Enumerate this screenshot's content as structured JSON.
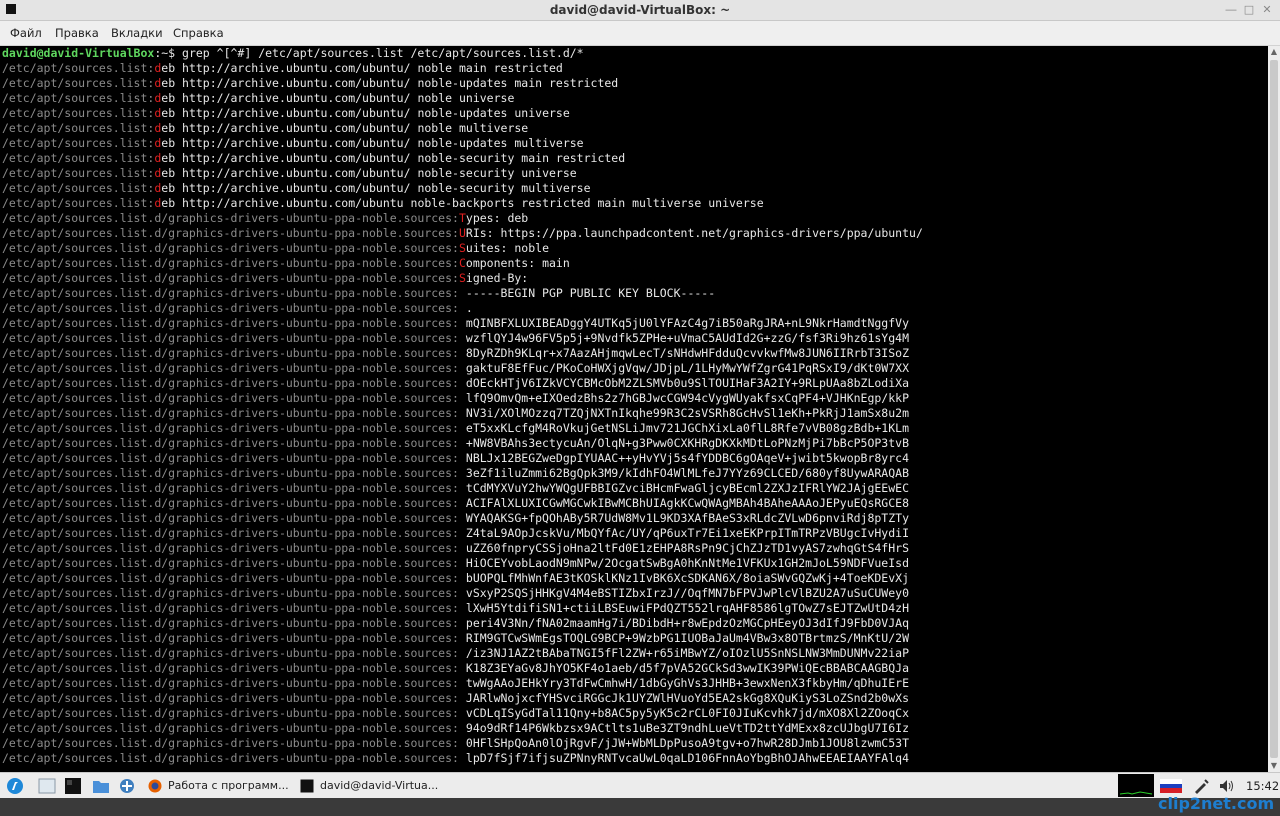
{
  "window": {
    "title": "david@david-VirtualBox: ~",
    "controls": [
      "minimize-icon",
      "maximize-icon",
      "close-icon"
    ]
  },
  "menu": [
    "Файл",
    "Правка",
    "Вкладки",
    "Справка"
  ],
  "terminal": {
    "prompt": "david@david-VirtualBox",
    "prompt_suffix": ":~$ ",
    "command": "grep ^[^#] /etc/apt/sources.list /etc/apt/sources.list.d/*",
    "lines": [
      {
        "p": "/etc/apt/sources.list:",
        "h": "d",
        "r": "eb http://archive.ubuntu.com/ubuntu/ noble main restricted"
      },
      {
        "p": "/etc/apt/sources.list:",
        "h": "d",
        "r": "eb http://archive.ubuntu.com/ubuntu/ noble-updates main restricted"
      },
      {
        "p": "/etc/apt/sources.list:",
        "h": "d",
        "r": "eb http://archive.ubuntu.com/ubuntu/ noble universe"
      },
      {
        "p": "/etc/apt/sources.list:",
        "h": "d",
        "r": "eb http://archive.ubuntu.com/ubuntu/ noble-updates universe"
      },
      {
        "p": "/etc/apt/sources.list:",
        "h": "d",
        "r": "eb http://archive.ubuntu.com/ubuntu/ noble multiverse"
      },
      {
        "p": "/etc/apt/sources.list:",
        "h": "d",
        "r": "eb http://archive.ubuntu.com/ubuntu/ noble-updates multiverse"
      },
      {
        "p": "/etc/apt/sources.list:",
        "h": "d",
        "r": "eb http://archive.ubuntu.com/ubuntu/ noble-security main restricted"
      },
      {
        "p": "/etc/apt/sources.list:",
        "h": "d",
        "r": "eb http://archive.ubuntu.com/ubuntu/ noble-security universe"
      },
      {
        "p": "/etc/apt/sources.list:",
        "h": "d",
        "r": "eb http://archive.ubuntu.com/ubuntu/ noble-security multiverse"
      },
      {
        "p": "/etc/apt/sources.list:",
        "h": "d",
        "r": "eb http://archive.ubuntu.com/ubuntu noble-backports restricted main multiverse universe"
      },
      {
        "p": "/etc/apt/sources.list.d/graphics-drivers-ubuntu-ppa-noble.sources:",
        "h": "T",
        "r": "ypes: deb"
      },
      {
        "p": "/etc/apt/sources.list.d/graphics-drivers-ubuntu-ppa-noble.sources:",
        "h": "U",
        "r": "RIs: https://ppa.launchpadcontent.net/graphics-drivers/ppa/ubuntu/"
      },
      {
        "p": "/etc/apt/sources.list.d/graphics-drivers-ubuntu-ppa-noble.sources:",
        "h": "S",
        "r": "uites: noble"
      },
      {
        "p": "/etc/apt/sources.list.d/graphics-drivers-ubuntu-ppa-noble.sources:",
        "h": "C",
        "r": "omponents: main"
      },
      {
        "p": "/etc/apt/sources.list.d/graphics-drivers-ubuntu-ppa-noble.sources:",
        "h": "S",
        "r": "igned-By:"
      },
      {
        "p": "/etc/apt/sources.list.d/graphics-drivers-ubuntu-ppa-noble.sources:",
        "h": "",
        "r": " -----BEGIN PGP PUBLIC KEY BLOCK-----"
      },
      {
        "p": "/etc/apt/sources.list.d/graphics-drivers-ubuntu-ppa-noble.sources:",
        "h": "",
        "r": " ."
      },
      {
        "p": "/etc/apt/sources.list.d/graphics-drivers-ubuntu-ppa-noble.sources:",
        "h": "",
        "r": " mQINBFXLUXIBEADggY4UTKq5jU0lYFAzC4g7iB50aRgJRA+nL9NkrHamdtNggfVy"
      },
      {
        "p": "/etc/apt/sources.list.d/graphics-drivers-ubuntu-ppa-noble.sources:",
        "h": "",
        "r": " wzflQYJ4w96FV5p5j+9Nvdfk5ZPHe+uVmaC5AUdId2G+zzG/fsf3Ri9hz61sYg4M"
      },
      {
        "p": "/etc/apt/sources.list.d/graphics-drivers-ubuntu-ppa-noble.sources:",
        "h": "",
        "r": " 8DyRZDh9KLqr+x7AazAHjmqwLecT/sNHdwHFdduQcvvkwfMw8JUN6IIRrbT3ISoZ"
      },
      {
        "p": "/etc/apt/sources.list.d/graphics-drivers-ubuntu-ppa-noble.sources:",
        "h": "",
        "r": " gaktuF8EfFuc/PKoCoHWXjgVqw/JDjpL/1LHyMwYWfZgrG41PqRSxI9/dKt0W7XX"
      },
      {
        "p": "/etc/apt/sources.list.d/graphics-drivers-ubuntu-ppa-noble.sources:",
        "h": "",
        "r": " dOEckHTjV6IZkVCYCBMcObM2ZLSMVb0u9SlTOUIHaF3A2IY+9RLpUAa8bZLodiXa"
      },
      {
        "p": "/etc/apt/sources.list.d/graphics-drivers-ubuntu-ppa-noble.sources:",
        "h": "",
        "r": " lfQ9OmvQm+eIXOedzBhs2z7hGBJwcCGW94cVygWUyakfsxCqPF4+VJHKnEgp/kkP"
      },
      {
        "p": "/etc/apt/sources.list.d/graphics-drivers-ubuntu-ppa-noble.sources:",
        "h": "",
        "r": " NV3i/XOlMOzzq7TZQjNXTnIkqhe99R3C2sVSRh8GcHvSl1eKh+PkRjJ1amSx8u2m"
      },
      {
        "p": "/etc/apt/sources.list.d/graphics-drivers-ubuntu-ppa-noble.sources:",
        "h": "",
        "r": " eT5xxKLcfgM4RoVkujGetNSLiJmv721JGChXixLa0flL8Rfe7vVB08gzBdb+1KLm"
      },
      {
        "p": "/etc/apt/sources.list.d/graphics-drivers-ubuntu-ppa-noble.sources:",
        "h": "",
        "r": " +NW8VBAhs3ectycuAn/OlqN+g3Pww0CXKHRgDKXkMDtLoPNzMjPi7bBcP5OP3tvB"
      },
      {
        "p": "/etc/apt/sources.list.d/graphics-drivers-ubuntu-ppa-noble.sources:",
        "h": "",
        "r": " NBLJx12BEGZweDgpIYUAAC++yHvYVj5s4fYDDBC6gOAqeV+jwibt5kwopBr8yrc4"
      },
      {
        "p": "/etc/apt/sources.list.d/graphics-drivers-ubuntu-ppa-noble.sources:",
        "h": "",
        "r": " 3eZf1iluZmmi62BgQpk3M9/kIdhFO4WlMLfeJ7YYz69CLCED/680yf8UywARAQAB"
      },
      {
        "p": "/etc/apt/sources.list.d/graphics-drivers-ubuntu-ppa-noble.sources:",
        "h": "",
        "r": " tCdMYXVuY2hwYWQgUFBBIGZvciBHcmFwaGljcyBEcml2ZXJzIFRlYW2JAjgEEwEC"
      },
      {
        "p": "/etc/apt/sources.list.d/graphics-drivers-ubuntu-ppa-noble.sources:",
        "h": "",
        "r": " ACIFAlXLUXICGwMGCwkIBwMCBhUIAgkKCwQWAgMBAh4BAheAAAoJEPyuEQsRGCE8"
      },
      {
        "p": "/etc/apt/sources.list.d/graphics-drivers-ubuntu-ppa-noble.sources:",
        "h": "",
        "r": " WYAQAKSG+fpQOhABy5R7UdW8Mv1L9KD3XAfBAeS3xRLdcZVLwD6pnviRdj8pTZTy"
      },
      {
        "p": "/etc/apt/sources.list.d/graphics-drivers-ubuntu-ppa-noble.sources:",
        "h": "",
        "r": " Z4taL9AOpJcskVu/MbQYfAc/UY/qP6uxTr7Ei1xeEKPrpITmTRPzVBUgcIvHydiI"
      },
      {
        "p": "/etc/apt/sources.list.d/graphics-drivers-ubuntu-ppa-noble.sources:",
        "h": "",
        "r": " uZZ60fnpryCSSjoHna2ltFd0E1zEHPA8RsPn9CjChZJzTD1vyAS7zwhqGtS4fHrS"
      },
      {
        "p": "/etc/apt/sources.list.d/graphics-drivers-ubuntu-ppa-noble.sources:",
        "h": "",
        "r": " HiOCEYvobLaodN9mNPw/2OcgatSwBgA0hKnNtMe1VFKUx1GH2mJoL59NDFVueIsd"
      },
      {
        "p": "/etc/apt/sources.list.d/graphics-drivers-ubuntu-ppa-noble.sources:",
        "h": "",
        "r": " bUOPQLfMhWnfAE3tKOSklKNz1IvBK6XcSDKAN6X/8oiaSWvGQZwKj+4ToeKDEvXj"
      },
      {
        "p": "/etc/apt/sources.list.d/graphics-drivers-ubuntu-ppa-noble.sources:",
        "h": "",
        "r": " vSxyP2SQSjHHKgV4M4eBSTIZbxIrzJ//OqfMN7bFPVJwPlcVlBZU2A7uSuCUWey0"
      },
      {
        "p": "/etc/apt/sources.list.d/graphics-drivers-ubuntu-ppa-noble.sources:",
        "h": "",
        "r": " lXwH5YtdifiSN1+ctiiLBSEuwiFPdQZT552lrqAHF8586lgTOwZ7sEJTZwUtD4zH"
      },
      {
        "p": "/etc/apt/sources.list.d/graphics-drivers-ubuntu-ppa-noble.sources:",
        "h": "",
        "r": " peri4V3Nn/fNA02maamHg7i/BDibdH+r8wEpdzOzMGCpHEeyOJ3dIfJ9FbD0VJAq"
      },
      {
        "p": "/etc/apt/sources.list.d/graphics-drivers-ubuntu-ppa-noble.sources:",
        "h": "",
        "r": " RIM9GTCwSWmEgsTOQLG9BCP+9WzbPG1IUOBaJaUm4VBw3x8OTBrtmzS/MnKtU/2W"
      },
      {
        "p": "/etc/apt/sources.list.d/graphics-drivers-ubuntu-ppa-noble.sources:",
        "h": "",
        "r": " /iz3NJ1AZ2tBAbaTNGI5fFl2ZW+r65iMBwYZ/oIOzlU5SnNSLNW3MmDUNMv22iaP"
      },
      {
        "p": "/etc/apt/sources.list.d/graphics-drivers-ubuntu-ppa-noble.sources:",
        "h": "",
        "r": " K18Z3EYaGv8JhYO5KF4o1aeb/d5f7pVA52GCkSd3wwIK39PWiQEcBBABCAAGBQJa"
      },
      {
        "p": "/etc/apt/sources.list.d/graphics-drivers-ubuntu-ppa-noble.sources:",
        "h": "",
        "r": " twWgAAoJEHkYry3TdFwCmhwH/1dbGyGhVs3JHHB+3ewxNenX3fkbyHm/qDhuIErE"
      },
      {
        "p": "/etc/apt/sources.list.d/graphics-drivers-ubuntu-ppa-noble.sources:",
        "h": "",
        "r": " JARlwNojxcfYHSvciRGGcJk1UYZWlHVuoYd5EA2skGg8XQuKiyS3LoZSnd2b0wXs"
      },
      {
        "p": "/etc/apt/sources.list.d/graphics-drivers-ubuntu-ppa-noble.sources:",
        "h": "",
        "r": " vCDLqISyGdTal11Qny+b8AC5py5yK5c2rCL0FI0JIuKcvhk7jd/mXO8Xl2ZOoqCx"
      },
      {
        "p": "/etc/apt/sources.list.d/graphics-drivers-ubuntu-ppa-noble.sources:",
        "h": "",
        "r": " 94o9dRf14P6Wkbzsx9ACtlts1uBe3ZT9ndhLueVtTD2ttYdMExx8zcUJbgU7I6Iz"
      },
      {
        "p": "/etc/apt/sources.list.d/graphics-drivers-ubuntu-ppa-noble.sources:",
        "h": "",
        "r": " 0HFlSHpQoAn0lOjRgvF/jJW+WbMLDpPusoA9tgv+o7hwR28DJmb1JOU8lzwmC53T"
      },
      {
        "p": "/etc/apt/sources.list.d/graphics-drivers-ubuntu-ppa-noble.sources:",
        "h": "",
        "r": " lpD7fSjf7ifjsuZPNnyRNTvcaUwL0qaLD106FnnAoYbgBhOJAhwEEAEIAAYFAlq4"
      }
    ]
  },
  "taskbar": {
    "tasks": [
      {
        "label": "Работа с программ...",
        "icon": "firefox-icon"
      },
      {
        "label": "david@david-Virtua...",
        "icon": "terminal-icon"
      }
    ],
    "clock": "15:42",
    "tray_icons": [
      "network-monitor-icon",
      "ru-flag-icon",
      "pen-icon",
      "volume-icon"
    ]
  },
  "watermark": "clip2net.com"
}
